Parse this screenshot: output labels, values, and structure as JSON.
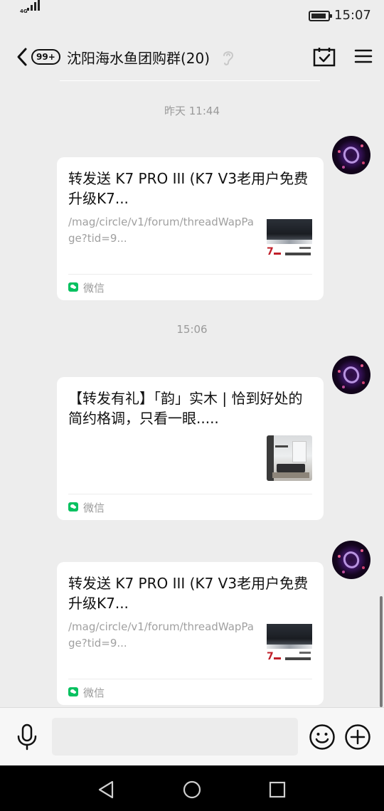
{
  "status_bar": {
    "network": "4G",
    "time": "15:07",
    "battery_level": 0.9
  },
  "header": {
    "unread_badge": "99+",
    "title": "沈阳海水鱼团购群(20)",
    "icons": [
      "back-icon",
      "ear-icon",
      "calendar-check-icon",
      "menu-icon"
    ]
  },
  "messages": [
    {
      "timestamp": "昨天 11:44",
      "card": {
        "title": "转发送 K7 PRO III (K7 V3老用户免费升级K7...",
        "description": "/mag/circle/v1/forum/threadWapPage?tid=9...",
        "thumbnail": "k7-product-thumbnail",
        "thumb_brand": "7",
        "source": "微信"
      }
    },
    {
      "timestamp": "15:06",
      "card": {
        "title": "【转发有礼】「韵」实木 | 恰到好处的简约格调，只看一眼.....",
        "description": "",
        "thumbnail": "living-room-thumbnail",
        "source": "微信"
      }
    },
    {
      "timestamp": "",
      "card": {
        "title": "转发送 K7 PRO III (K7 V3老用户免费升级K7...",
        "description": "/mag/circle/v1/forum/threadWapPage?tid=9...",
        "thumbnail": "k7-product-thumbnail",
        "thumb_brand": "7",
        "source": "微信"
      }
    }
  ],
  "input_bar": {
    "placeholder": "",
    "icons": [
      "microphone-icon",
      "emoji-icon",
      "plus-icon"
    ]
  },
  "nav_bar": {
    "icons": [
      "nav-back-icon",
      "nav-home-icon",
      "nav-recents-icon"
    ]
  },
  "colors": {
    "background": "#ededed",
    "card": "#ffffff",
    "wechat_green": "#07c160",
    "muted_text": "#9a9a9a"
  }
}
